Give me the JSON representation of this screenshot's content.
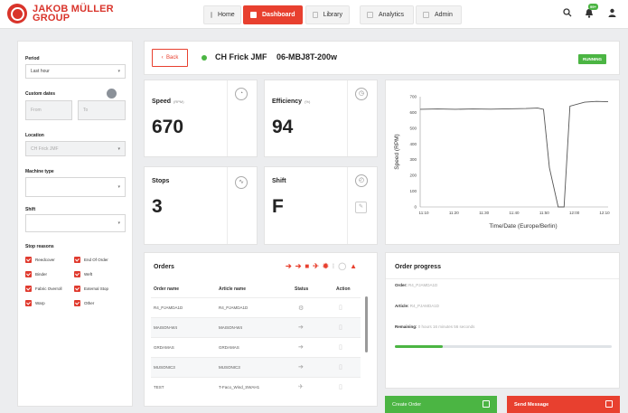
{
  "brand": {
    "line1": "JAKOB MÜLLER",
    "line2": "GROUP"
  },
  "nav": [
    {
      "label": "Home",
      "active": false
    },
    {
      "label": "Dashboard",
      "active": true
    },
    {
      "label": "Library",
      "active": false
    },
    {
      "label": "Analytics",
      "active": false
    },
    {
      "label": "Admin",
      "active": false
    }
  ],
  "topbar": {
    "notif_badge": "99+"
  },
  "filters": {
    "period_label": "Period",
    "period_value": "Last hour",
    "custom_dates_label": "Custom dates",
    "from_placeholder": "From",
    "to_placeholder": "To",
    "location_label": "Location",
    "location_value": "CH Frick JMF",
    "machine_type_label": "Machine type",
    "shift_label": "Shift",
    "stop_reasons_label": "Stop reasons",
    "stop_reasons": [
      "Reedcover",
      "End Of Order",
      "Binder",
      "Weft",
      "Fabric Overroll",
      "External Stop",
      "Warp",
      "Other"
    ]
  },
  "header": {
    "back_label": "Back",
    "location": "CH Frick JMF",
    "machine": "06-MBJ8T-200w",
    "status": "RUNNING",
    "status_color": "#4bb543"
  },
  "kpis": {
    "speed": {
      "title": "Speed",
      "unit": "(RPM)",
      "value": "670"
    },
    "efficiency": {
      "title": "Efficiency",
      "unit": "(%)",
      "value": "94"
    },
    "stops": {
      "title": "Stops",
      "value": "3"
    },
    "shift": {
      "title": "Shift",
      "value": "F"
    }
  },
  "chart_data": {
    "type": "line",
    "xlabel": "Time/Date (Europe/Berlin)",
    "ylabel": "Speed (RPM)",
    "xticks": [
      "11:10",
      "11:20",
      "11:30",
      "11:40",
      "11:50",
      "12:00",
      "12:10"
    ],
    "yticks": [
      0,
      100,
      200,
      300,
      400,
      500,
      600,
      700
    ],
    "ylim": [
      0,
      700
    ],
    "grid": false,
    "series": [
      {
        "x": [
          0,
          6,
          12,
          18,
          24,
          30,
          36,
          40,
          42,
          44,
          47,
          49,
          51,
          56,
          60,
          64
        ],
        "values": [
          620,
          622,
          620,
          622,
          621,
          623,
          625,
          628,
          620,
          250,
          0,
          0,
          640,
          665,
          670,
          668
        ]
      }
    ]
  },
  "orders": {
    "title": "Orders",
    "columns": [
      "Order name",
      "Article name",
      "Status",
      "Action"
    ],
    "rows": [
      {
        "order": "R4_PJAMDA1D",
        "article": "R4_PJAMDA1D"
      },
      {
        "order": "MAISON-W4",
        "article": "MAISON-W4"
      },
      {
        "order": "GRDAMAS",
        "article": "GRDAMAS"
      },
      {
        "order": "MUSONIC3",
        "article": "MUSONIC3"
      },
      {
        "order": "TEST",
        "article": "T-Faco_Wind_SWAH1"
      }
    ]
  },
  "progress": {
    "title": "Order progress",
    "order_label": "Order:",
    "order_value": "R4_PJAMDA1D",
    "article_label": "Article:",
    "article_value": "R4_PJAMDA1D",
    "remaining_label": "Remaining:",
    "remaining_value": "0 hours 16 minutes 56 seconds",
    "fraction": 0.22
  },
  "actions": {
    "create_order": "Create Order",
    "send_message": "Send Message"
  }
}
